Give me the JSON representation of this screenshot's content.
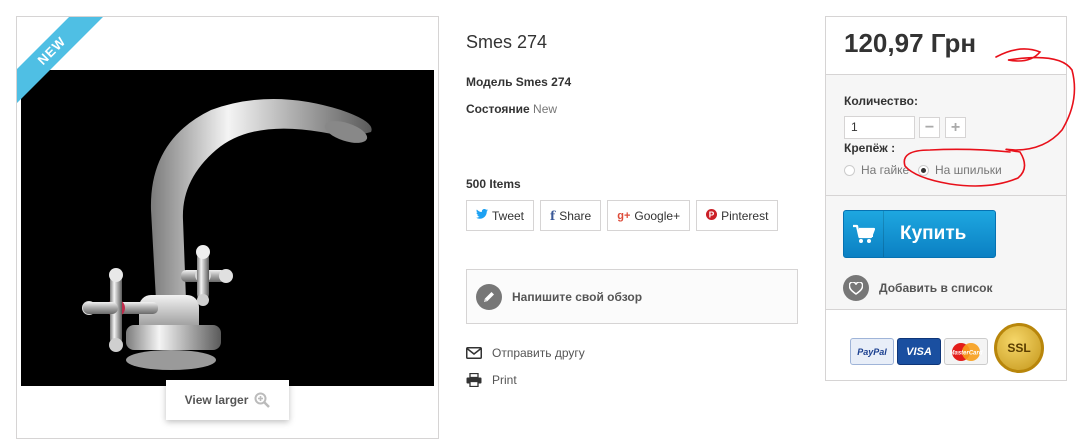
{
  "badge": {
    "new_label": "NEW"
  },
  "image": {
    "view_larger_label": "View larger",
    "zoom_icon": "zoom-in-icon"
  },
  "product": {
    "title": "Smes 274",
    "model_label": "Модель Smes 274",
    "condition_label": "Состояние",
    "condition_value": "New",
    "stock_label": "500 Items"
  },
  "social": [
    {
      "icon": "twitter-icon",
      "icon_glyph": "🐦",
      "label": "Tweet",
      "color": "#1da1f2"
    },
    {
      "icon": "facebook-icon",
      "icon_glyph": "f",
      "label": "Share",
      "color": "#3b5998"
    },
    {
      "icon": "google-plus-icon",
      "icon_glyph": "g+",
      "label": "Google+",
      "color": "#dd4b39"
    },
    {
      "icon": "pinterest-icon",
      "icon_glyph": "P",
      "label": "Pinterest",
      "color": "#cb2027"
    }
  ],
  "review": {
    "label": "Напишите свой обзор",
    "icon": "pencil-icon"
  },
  "links": {
    "send_friend": "Отправить другу",
    "print": "Print"
  },
  "buy": {
    "price": "120,97 Грн",
    "quantity_label": "Количество:",
    "quantity_value": "1",
    "minus_label": "−",
    "plus_label": "+",
    "attribute_label": "Крепёж :",
    "options": [
      {
        "label": "На гайке",
        "checked": false
      },
      {
        "label": "На шпильки",
        "checked": true
      }
    ],
    "buy_button_label": "Купить",
    "wishlist_label": "Добавить в список",
    "accent_color": "#0b80c3"
  },
  "payments": [
    {
      "label": "PayPal",
      "bg": "#e8eef8",
      "fg": "#1a3f8f"
    },
    {
      "label": "VISA",
      "bg": "#1a4fa0",
      "fg": "#ffffff"
    },
    {
      "label": "MasterCard",
      "bg": "#f7f7f7",
      "fg": "#cc0000"
    }
  ],
  "ssl_label": "SSL"
}
